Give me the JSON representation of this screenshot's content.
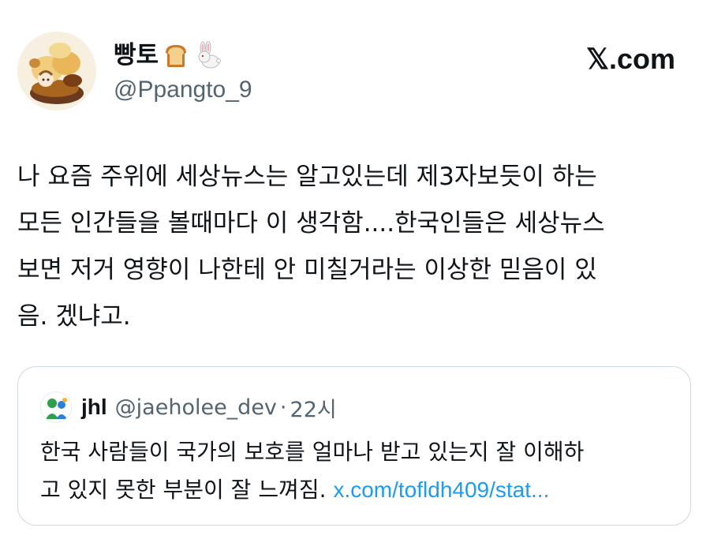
{
  "author": {
    "display_name": "빵토",
    "emojis": [
      "bread-emoji",
      "rabbit-emoji"
    ],
    "handle": "@Ppangto_9"
  },
  "brand": "𝕏.com",
  "tweet": {
    "lines": [
      "나 요즘 주위에 세상뉴스는 알고있는데 제3자보듯이 하는",
      "모든 인간들을 볼때마다 이 생각함....한국인들은 세상뉴스",
      "보면 저거 영향이 나한테 안 미칠거라는 이상한 믿음이 있",
      "음. 겠냐고."
    ]
  },
  "quoted_tweet": {
    "display_name": "jhl",
    "handle": "@jaeholee_dev",
    "separator": "·",
    "time": "22시",
    "line1": "한국 사람들이 국가의 보호를 얼마나 받고 있는지 잘 이해하",
    "line2": "고 있지 못한 부분이 잘 느껴짐. ",
    "link": "x.com/tofldh409/stat..."
  },
  "colors": {
    "text_primary": "#0f1419",
    "text_secondary": "#536471",
    "link": "#1d9bf0",
    "border": "#cfd9de"
  }
}
